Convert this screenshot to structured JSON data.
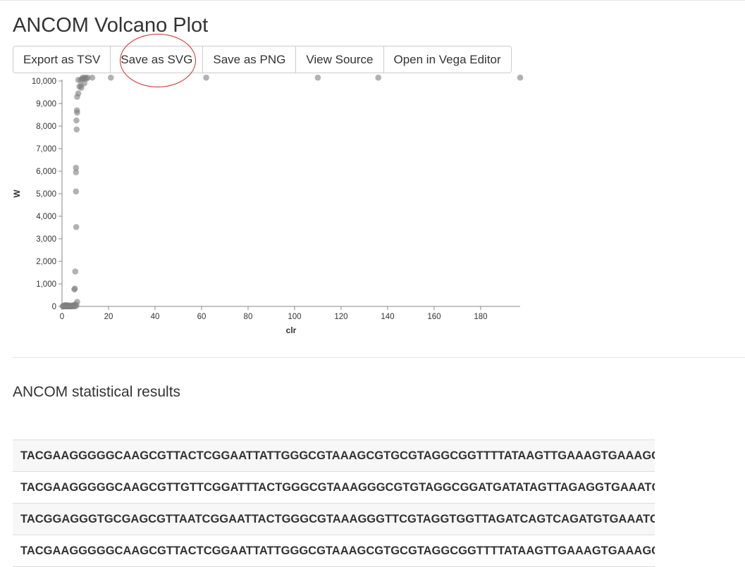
{
  "page": {
    "title": "ANCOM Volcano Plot"
  },
  "toolbar": {
    "buttons": [
      {
        "label": "Export as TSV"
      },
      {
        "label": "Save as SVG"
      },
      {
        "label": "Save as PNG"
      },
      {
        "label": "View Source"
      },
      {
        "label": "Open in Vega Editor"
      }
    ],
    "highlight_color": "#d42a2a"
  },
  "chart_data": {
    "type": "scatter",
    "title": "",
    "xlabel": "clr",
    "ylabel": "W",
    "xlim": [
      0,
      197
    ],
    "ylim": [
      0,
      10000
    ],
    "x_ticks": [
      0,
      20,
      40,
      60,
      80,
      100,
      120,
      140,
      160,
      180
    ],
    "x_tick_labels": [
      "0",
      "20",
      "40",
      "60",
      "80",
      "100",
      "120",
      "140",
      "160",
      "180"
    ],
    "y_ticks": [
      0,
      1000,
      2000,
      3000,
      4000,
      5000,
      6000,
      7000,
      8000,
      9000,
      10000
    ],
    "y_tick_labels": [
      "0",
      "1,000",
      "2,000",
      "3,000",
      "4,000",
      "5,000",
      "6,000",
      "7,000",
      "8,000",
      "9,000",
      "10,000"
    ],
    "grid": false,
    "point_color": "#7f7f7f",
    "point_opacity": 0.6,
    "series": [
      {
        "points": [
          [
            0.3,
            0
          ],
          [
            0.5,
            10
          ],
          [
            0.8,
            5
          ],
          [
            1.0,
            0
          ],
          [
            1.2,
            20
          ],
          [
            1.5,
            0
          ],
          [
            1.8,
            15
          ],
          [
            2.0,
            0
          ],
          [
            2.2,
            30
          ],
          [
            2.5,
            0
          ],
          [
            2.8,
            10
          ],
          [
            3.0,
            0
          ],
          [
            3.2,
            25
          ],
          [
            3.5,
            5
          ],
          [
            3.8,
            0
          ],
          [
            4.0,
            40
          ],
          [
            4.3,
            10
          ],
          [
            4.6,
            0
          ],
          [
            5.0,
            60
          ],
          [
            5.3,
            20
          ],
          [
            5.6,
            0
          ],
          [
            1.0,
            40
          ],
          [
            2.0,
            50
          ],
          [
            3.0,
            35
          ],
          [
            1.5,
            60
          ],
          [
            0.6,
            30
          ],
          [
            2.6,
            45
          ],
          [
            4.8,
            30
          ],
          [
            5.8,
            90
          ],
          [
            6.2,
            40
          ],
          [
            6.5,
            200
          ],
          [
            5.3,
            750
          ],
          [
            5.5,
            790
          ],
          [
            5.7,
            1550
          ],
          [
            6.1,
            3520
          ],
          [
            6.0,
            5100
          ],
          [
            6.0,
            5950
          ],
          [
            6.0,
            6150
          ],
          [
            6.3,
            7850
          ],
          [
            6.2,
            8250
          ],
          [
            6.5,
            8600
          ],
          [
            6.4,
            8700
          ],
          [
            6.5,
            9300
          ],
          [
            7.0,
            9450
          ],
          [
            7.5,
            9750
          ],
          [
            8.0,
            9800
          ],
          [
            8.3,
            9700
          ],
          [
            7.0,
            10050
          ],
          [
            8.0,
            10050
          ],
          [
            8.6,
            10100
          ],
          [
            9.0,
            10150
          ],
          [
            9.5,
            10100
          ],
          [
            10.0,
            10150
          ],
          [
            10.5,
            10100
          ],
          [
            11.0,
            10150
          ],
          [
            9.6,
            9900
          ],
          [
            13.0,
            10150
          ],
          [
            21.0,
            10150
          ],
          [
            62.0,
            10150
          ],
          [
            110.0,
            10150
          ],
          [
            136.0,
            10150
          ],
          [
            197.0,
            10150
          ]
        ]
      }
    ]
  },
  "results": {
    "section_title": "ANCOM statistical results",
    "rows": [
      "TACGAAGGGGGCAAGCGTTACTCGGAATTATTGGGCGTAAAGCGTGCGTAGGCGGTTTTATAAGTTGAAAGTGAAAGCCCTGGGCTCAACCTAGGAACTGCTTTCAAAACTGATAAGCTAGAGTATGGGAGAGGTGAGTGGAATTC",
      "TACGAAGGGGGCAAGCGTTGTTCGGATTTACTGGGCGTAAAGGGCGTGTAGGCGGATGATATAGTTAGAGGTGAAATCCTGGAGCTTAACTCCAGAACTGCCTTTAATACTGTTATCCTTGAGTATGGGAGAGGTGAGTGGAA",
      "TACGGAGGGTGCGAGCGTTAATCGGAATTACTGGGCGTAAAGGGTTCGTAGGTGGTTAGATCAGTCAGATGTGAAATCCCAGGGCTCAACCTTGGAACTGCATTTGAAACTGGTCTACTAGAGTATGGGAGAGGTGAGTGGAA",
      "TACGAAGGGGGCAAGCGTTACTCGGAATTATTGGGCGTAAAGCGTGCGTAGGCGGTTTTATAAGTTGAAAGTGAAAGCCCTGGGCTCAACCTAGGAACTGCTTTCAAAACTGATAAGCTAGAGTATGGGAGAGGTGAGTGGAA"
    ]
  }
}
